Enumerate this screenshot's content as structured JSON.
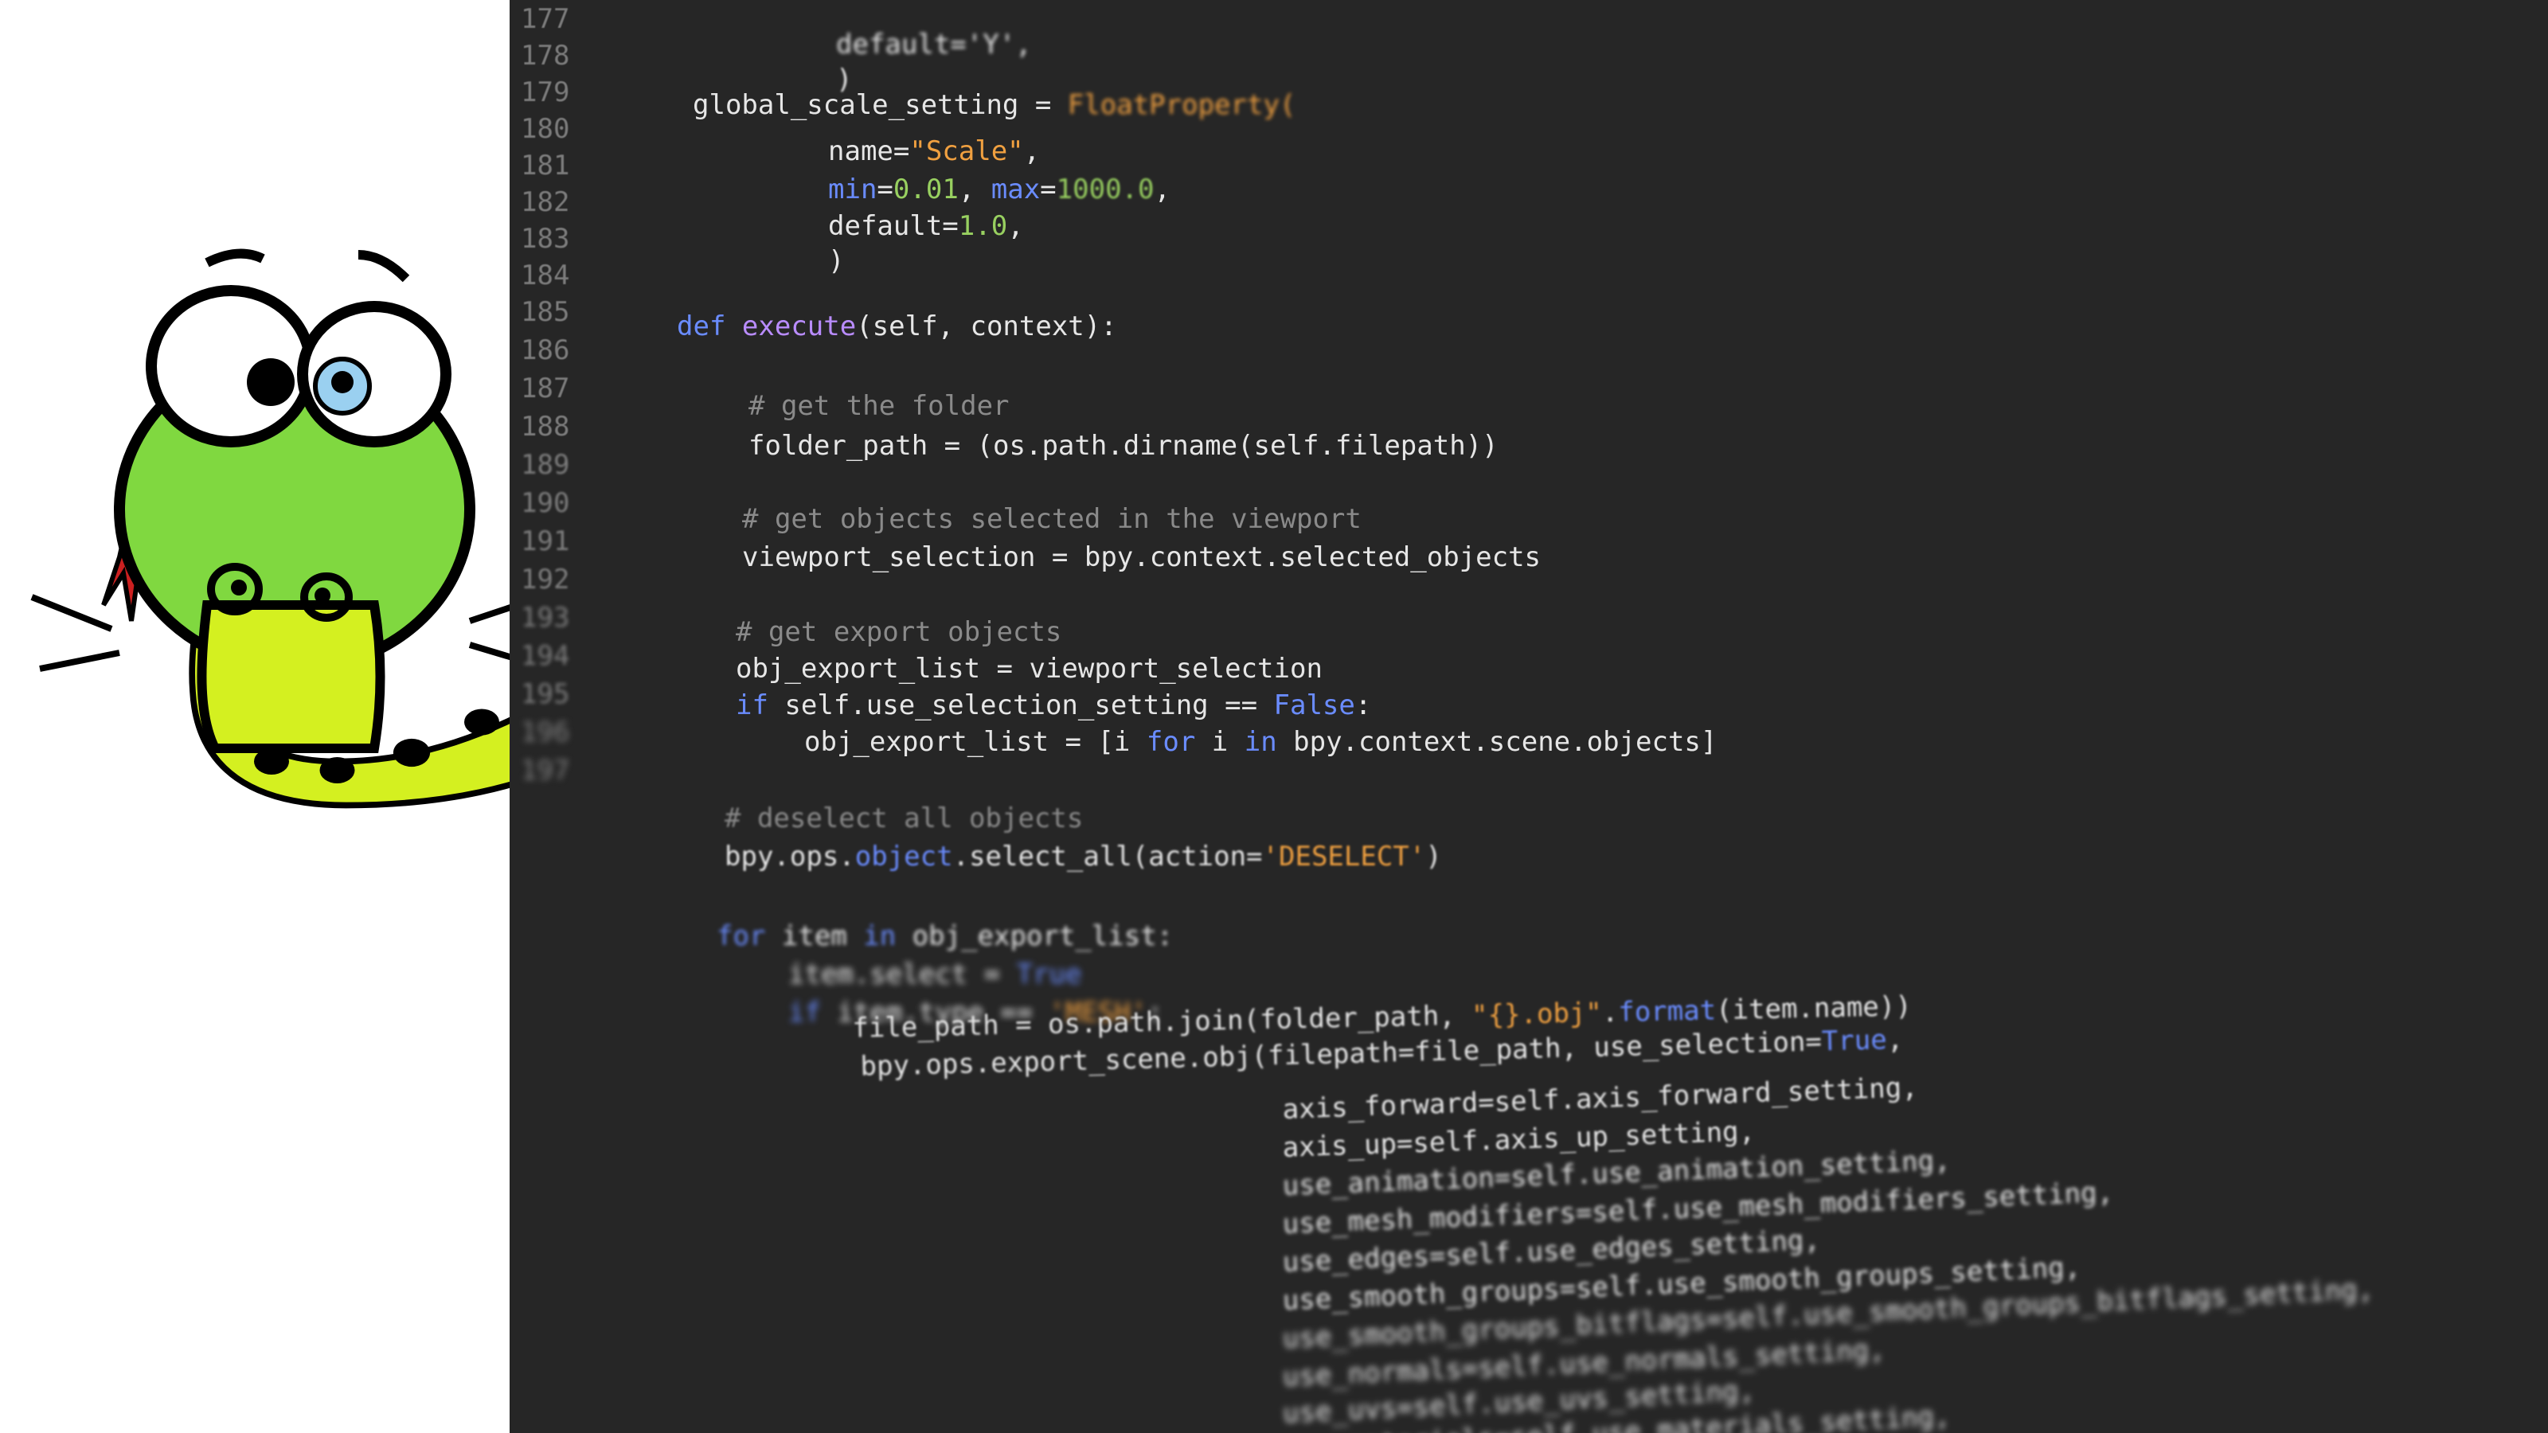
{
  "gutter": [
    "177",
    "178",
    "179",
    "180",
    "181",
    "182",
    "183",
    "184",
    "185",
    "186",
    "187",
    "188",
    "189",
    "190",
    "191",
    "192",
    "193",
    "194",
    "195",
    "196",
    "197"
  ],
  "code": {
    "l1": "default='Y',",
    "l2": ")",
    "l3_a": "global_scale_setting",
    "l3_b": " = ",
    "l3_c": "FloatProperty(",
    "l4_a": "name=",
    "l4_b": "\"Scale\"",
    "l4_c": ",",
    "l5_a": "min",
    "l5_b": "=",
    "l5_c": "0.01",
    "l5_d": ", ",
    "l5_e": "max",
    "l5_f": "=",
    "l5_g": "1000.0",
    "l5_h": ",",
    "l6_a": "default=",
    "l6_b": "1.0",
    "l6_c": ",",
    "l7": ")",
    "def_kw": "def",
    "def_fn": "execute",
    "def_rest": "(self, context):",
    "c1": "# get the folder",
    "l9": "folder_path = (os.path.dirname(self.filepath))",
    "c2": "# get objects selected in the viewport",
    "l10": "viewport_selection = bpy.context.selected_objects",
    "c3": "# get export objects",
    "l11": "obj_export_list = viewport_selection",
    "l12_kw": "if",
    "l12_a": " self.use_selection_setting == ",
    "l12_b": "False",
    "l12_c": ":",
    "l13_a": "obj_export_list = [i ",
    "l13_kw1": "for",
    "l13_b": " i ",
    "l13_kw2": "in",
    "l13_c": " bpy.context.scene.objects]",
    "c4": "# deselect all objects",
    "l14_a": "bpy.ops.",
    "l14_b": "object",
    "l14_c": ".select_all(action=",
    "l14_d": "'DESELECT'",
    "l14_e": ")",
    "l15_kw1": "for",
    "l15_a": " item ",
    "l15_kw2": "in",
    "l15_b": " obj_export_list:",
    "l16_a": "item.select = ",
    "l16_b": "True",
    "l17_kw": "if",
    "l17_a": " item.type == ",
    "l17_b": "'MESH'",
    "l17_c": ":",
    "l18_a": "file_path = os.path.join(folder_path, ",
    "l18_b": "\"{}.obj\"",
    "l18_c": ".",
    "l18_d": "format",
    "l18_e": "(item.name))",
    "l19_a": "bpy.ops.export_scene.obj(filepath=file_path, use_selection=",
    "l19_b": "True",
    "l19_c": ",",
    "l20": "axis_forward=self.axis_forward_setting,",
    "l21": "axis_up=self.axis_up_setting,",
    "l22": "use_animation=self.use_animation_setting,",
    "l23": "use_mesh_modifiers=self.use_mesh_modifiers_setting,",
    "l24": "use_edges=self.use_edges_setting,",
    "l25": "use_smooth_groups=self.use_smooth_groups_setting,",
    "l26": "use_smooth_groups_bitflags=self.use_smooth_groups_bitflags_setting,",
    "l27": "use_normals=self.use_normals_setting,",
    "l28": "use_uvs=self.use_uvs_setting,",
    "l29": "use_materials=self.use_materials_setting,"
  },
  "colors": {
    "editor_bg": "#262626",
    "snake_green": "#80d840",
    "snake_body": "#d4f020",
    "tongue": "#cc2020"
  },
  "icons": {
    "mascot": "snake-mascot-icon"
  }
}
